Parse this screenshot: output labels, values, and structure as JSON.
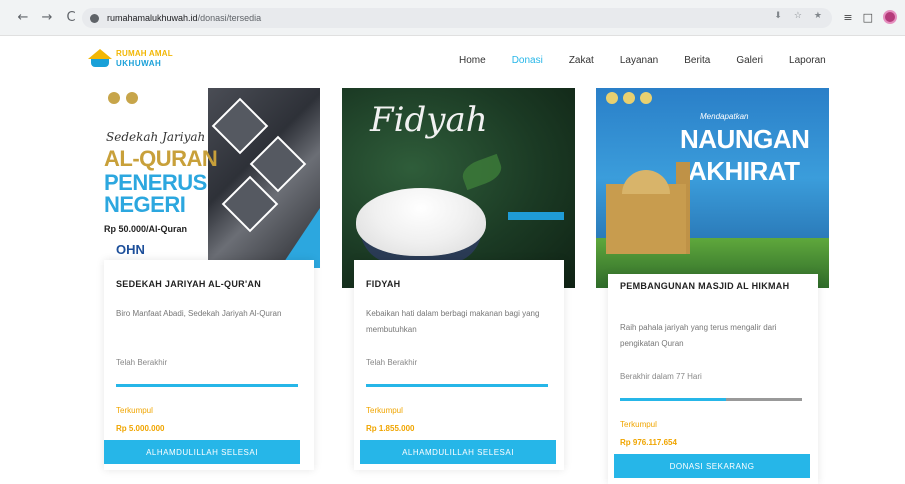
{
  "browser": {
    "nav": {
      "back": "←",
      "forward": "→",
      "reload": "C"
    },
    "url_host": "rumahamalukhuwah.id",
    "url_path": "/donasi/tersedia",
    "omni_icons": [
      "⬇",
      "☆",
      "★"
    ],
    "toolbar_icons": [
      "≡",
      "□"
    ]
  },
  "site": {
    "logo_line1": "RUMAH AMAL",
    "logo_line2": "UKHUWAH",
    "menu": [
      {
        "label": "Home",
        "active": false
      },
      {
        "label": "Donasi",
        "active": true
      },
      {
        "label": "Zakat",
        "active": false
      },
      {
        "label": "Layanan",
        "active": false
      },
      {
        "label": "Berita",
        "active": false
      },
      {
        "label": "Galeri",
        "active": false
      },
      {
        "label": "Laporan",
        "active": false
      }
    ],
    "accent": "#26b6e8"
  },
  "cards": [
    {
      "poster": {
        "script": "Sedekah Jariyah",
        "line1": "AL-QURAN",
        "line2": "PENERUS",
        "line3": "NEGERI",
        "price": "Rp 50.000/Al-Quran",
        "brand": "OHN"
      },
      "title": "SEDEKAH JARIYAH AL-QUR'AN",
      "desc": "Biro Manfaat Abadi, Sedekah Jariyah Al-Quran",
      "status": "Telah Berakhir",
      "progress": 1.0,
      "collected_label": "Terkumpul",
      "collected_amount": "Rp 5.000.000",
      "cta": "ALHAMDULILLAH SELESAI"
    },
    {
      "poster": {
        "title": "Fidyah"
      },
      "title": "FIDYAH",
      "desc": "Kebaikan hati dalam berbagi makanan bagi yang membutuhkan",
      "status": "Telah Berakhir",
      "progress": 1.0,
      "collected_label": "Terkumpul",
      "collected_amount": "Rp 1.855.000",
      "cta": "ALHAMDULILLAH SELESAI"
    },
    {
      "poster": {
        "heading1": "Mendapatkan",
        "heading2": "NAUNGAN",
        "heading3": "AKHIRAT"
      },
      "title": "PEMBANGUNAN MASJID AL HIKMAH",
      "desc": "Raih pahala jariyah yang terus mengalir dari pengikatan Quran",
      "status": "Berakhir dalam 77 Hari",
      "progress": 0.58,
      "collected_label": "Terkumpul",
      "collected_amount": "Rp 976.117.654",
      "cta": "DONASI SEKARANG"
    }
  ]
}
